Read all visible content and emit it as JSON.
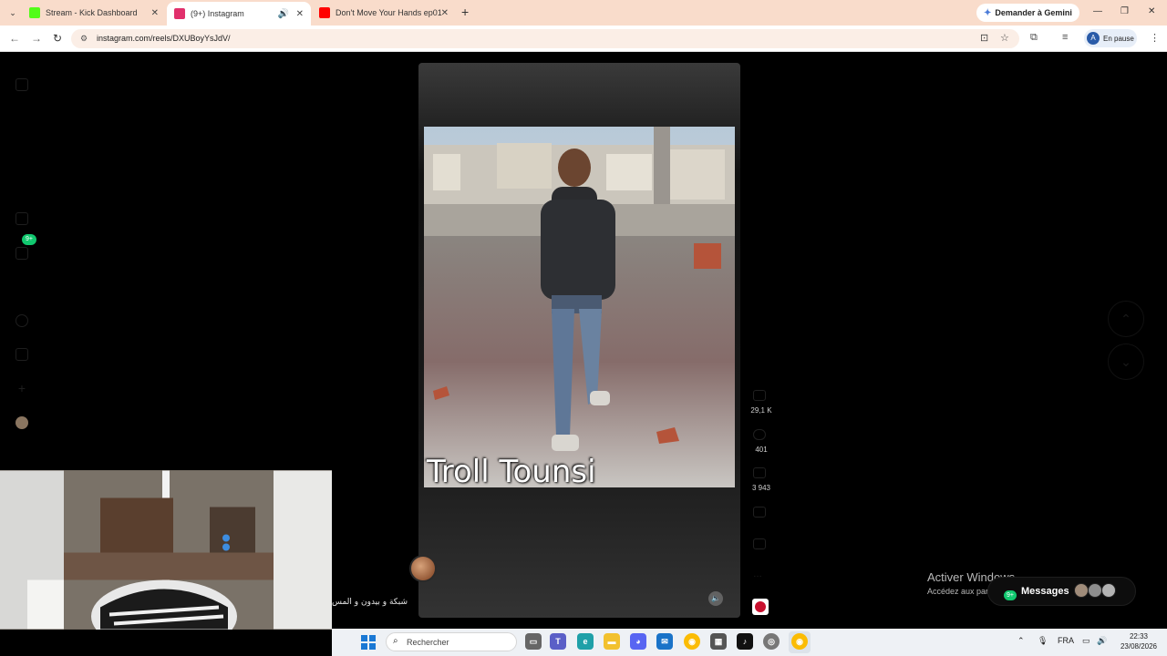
{
  "browser": {
    "tabs": [
      {
        "label": "Stream - Kick Dashboard",
        "favicon_color": "#53fc18"
      },
      {
        "label": "(9+) Instagram",
        "favicon_color": "#e1306c"
      },
      {
        "label": "Don't Move Your Hands ep01 🔥",
        "favicon_color": "#ff0000"
      }
    ],
    "new_tab": "+",
    "gemini_button": "Demander à Gemini",
    "url": "instagram.com/reels/DXUBoyYsJdV/",
    "profile_initial": "A",
    "profile_status": "En pause"
  },
  "sidebar": {
    "notification_badge": "9+"
  },
  "reel": {
    "caption_overlay": "Troll Tounsi",
    "likes": "29,1 K",
    "comments": "401",
    "shares": "3 943"
  },
  "overlay": {
    "arabic_text": "شبكة و بيدون و المس"
  },
  "windows": {
    "activate_title": "Activer Windows",
    "activate_subtitle": "Accédez aux param"
  },
  "messages": {
    "label": "Messages",
    "badge": "9+"
  },
  "taskbar": {
    "search_placeholder": "Rechercher",
    "language": "FRA",
    "time": "22:33",
    "date": "23/08/2026"
  }
}
